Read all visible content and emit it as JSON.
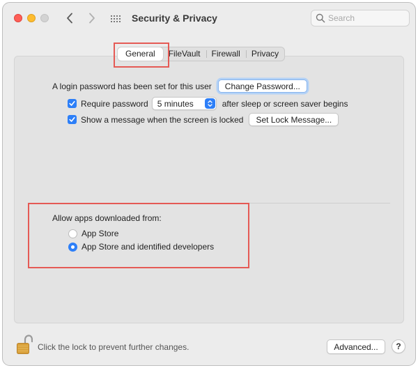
{
  "window": {
    "title": "Security & Privacy",
    "traffic_lights": [
      "close",
      "minimize",
      "zoom"
    ]
  },
  "toolbar": {
    "back_icon": "chevron-left-icon",
    "forward_icon": "chevron-right-icon",
    "grid_icon": "show-all-grid-icon",
    "search_placeholder": "Search",
    "search_value": ""
  },
  "tabs": [
    {
      "label": "General",
      "active": true
    },
    {
      "label": "FileVault",
      "active": false
    },
    {
      "label": "Firewall",
      "active": false
    },
    {
      "label": "Privacy",
      "active": false
    }
  ],
  "general": {
    "login_text": "A login password has been set for this user",
    "change_password_label": "Change Password...",
    "require_password": {
      "checked": true,
      "label": "Require password",
      "selected_value": "5 minutes",
      "suffix": "after sleep or screen saver begins"
    },
    "show_message": {
      "checked": true,
      "label": "Show a message when the screen is locked",
      "button_label": "Set Lock Message..."
    },
    "allow_apps": {
      "heading": "Allow apps downloaded from:",
      "options": [
        {
          "label": "App Store",
          "selected": false
        },
        {
          "label": "App Store and identified developers",
          "selected": true
        }
      ]
    }
  },
  "footer": {
    "lock_icon": "unlocked-padlock-icon",
    "lock_text": "Click the lock to prevent further changes.",
    "advanced_label": "Advanced...",
    "help_label": "?"
  },
  "colors": {
    "accent": "#2d7ff8",
    "highlight_annotation": "#e55a55",
    "close": "#fe5f57",
    "minimize": "#febc2e"
  }
}
